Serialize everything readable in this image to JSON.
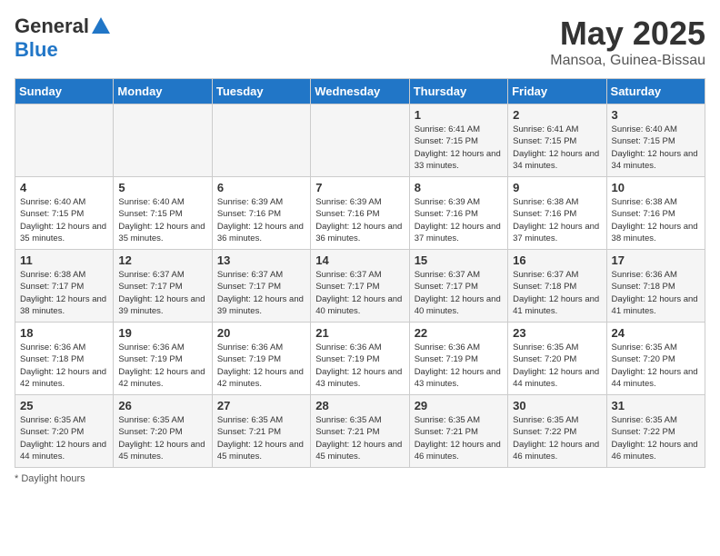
{
  "header": {
    "logo_general": "General",
    "logo_blue": "Blue",
    "title": "May 2025",
    "subtitle": "Mansoa, Guinea-Bissau"
  },
  "days_of_week": [
    "Sunday",
    "Monday",
    "Tuesday",
    "Wednesday",
    "Thursday",
    "Friday",
    "Saturday"
  ],
  "weeks": [
    [
      {
        "day": "",
        "sunrise": "",
        "sunset": "",
        "daylight": ""
      },
      {
        "day": "",
        "sunrise": "",
        "sunset": "",
        "daylight": ""
      },
      {
        "day": "",
        "sunrise": "",
        "sunset": "",
        "daylight": ""
      },
      {
        "day": "",
        "sunrise": "",
        "sunset": "",
        "daylight": ""
      },
      {
        "day": "1",
        "sunrise": "6:41 AM",
        "sunset": "7:15 PM",
        "daylight": "12 hours and 33 minutes."
      },
      {
        "day": "2",
        "sunrise": "6:41 AM",
        "sunset": "7:15 PM",
        "daylight": "12 hours and 34 minutes."
      },
      {
        "day": "3",
        "sunrise": "6:40 AM",
        "sunset": "7:15 PM",
        "daylight": "12 hours and 34 minutes."
      }
    ],
    [
      {
        "day": "4",
        "sunrise": "6:40 AM",
        "sunset": "7:15 PM",
        "daylight": "12 hours and 35 minutes."
      },
      {
        "day": "5",
        "sunrise": "6:40 AM",
        "sunset": "7:15 PM",
        "daylight": "12 hours and 35 minutes."
      },
      {
        "day": "6",
        "sunrise": "6:39 AM",
        "sunset": "7:16 PM",
        "daylight": "12 hours and 36 minutes."
      },
      {
        "day": "7",
        "sunrise": "6:39 AM",
        "sunset": "7:16 PM",
        "daylight": "12 hours and 36 minutes."
      },
      {
        "day": "8",
        "sunrise": "6:39 AM",
        "sunset": "7:16 PM",
        "daylight": "12 hours and 37 minutes."
      },
      {
        "day": "9",
        "sunrise": "6:38 AM",
        "sunset": "7:16 PM",
        "daylight": "12 hours and 37 minutes."
      },
      {
        "day": "10",
        "sunrise": "6:38 AM",
        "sunset": "7:16 PM",
        "daylight": "12 hours and 38 minutes."
      }
    ],
    [
      {
        "day": "11",
        "sunrise": "6:38 AM",
        "sunset": "7:17 PM",
        "daylight": "12 hours and 38 minutes."
      },
      {
        "day": "12",
        "sunrise": "6:37 AM",
        "sunset": "7:17 PM",
        "daylight": "12 hours and 39 minutes."
      },
      {
        "day": "13",
        "sunrise": "6:37 AM",
        "sunset": "7:17 PM",
        "daylight": "12 hours and 39 minutes."
      },
      {
        "day": "14",
        "sunrise": "6:37 AM",
        "sunset": "7:17 PM",
        "daylight": "12 hours and 40 minutes."
      },
      {
        "day": "15",
        "sunrise": "6:37 AM",
        "sunset": "7:17 PM",
        "daylight": "12 hours and 40 minutes."
      },
      {
        "day": "16",
        "sunrise": "6:37 AM",
        "sunset": "7:18 PM",
        "daylight": "12 hours and 41 minutes."
      },
      {
        "day": "17",
        "sunrise": "6:36 AM",
        "sunset": "7:18 PM",
        "daylight": "12 hours and 41 minutes."
      }
    ],
    [
      {
        "day": "18",
        "sunrise": "6:36 AM",
        "sunset": "7:18 PM",
        "daylight": "12 hours and 42 minutes."
      },
      {
        "day": "19",
        "sunrise": "6:36 AM",
        "sunset": "7:19 PM",
        "daylight": "12 hours and 42 minutes."
      },
      {
        "day": "20",
        "sunrise": "6:36 AM",
        "sunset": "7:19 PM",
        "daylight": "12 hours and 42 minutes."
      },
      {
        "day": "21",
        "sunrise": "6:36 AM",
        "sunset": "7:19 PM",
        "daylight": "12 hours and 43 minutes."
      },
      {
        "day": "22",
        "sunrise": "6:36 AM",
        "sunset": "7:19 PM",
        "daylight": "12 hours and 43 minutes."
      },
      {
        "day": "23",
        "sunrise": "6:35 AM",
        "sunset": "7:20 PM",
        "daylight": "12 hours and 44 minutes."
      },
      {
        "day": "24",
        "sunrise": "6:35 AM",
        "sunset": "7:20 PM",
        "daylight": "12 hours and 44 minutes."
      }
    ],
    [
      {
        "day": "25",
        "sunrise": "6:35 AM",
        "sunset": "7:20 PM",
        "daylight": "12 hours and 44 minutes."
      },
      {
        "day": "26",
        "sunrise": "6:35 AM",
        "sunset": "7:20 PM",
        "daylight": "12 hours and 45 minutes."
      },
      {
        "day": "27",
        "sunrise": "6:35 AM",
        "sunset": "7:21 PM",
        "daylight": "12 hours and 45 minutes."
      },
      {
        "day": "28",
        "sunrise": "6:35 AM",
        "sunset": "7:21 PM",
        "daylight": "12 hours and 45 minutes."
      },
      {
        "day": "29",
        "sunrise": "6:35 AM",
        "sunset": "7:21 PM",
        "daylight": "12 hours and 46 minutes."
      },
      {
        "day": "30",
        "sunrise": "6:35 AM",
        "sunset": "7:22 PM",
        "daylight": "12 hours and 46 minutes."
      },
      {
        "day": "31",
        "sunrise": "6:35 AM",
        "sunset": "7:22 PM",
        "daylight": "12 hours and 46 minutes."
      }
    ]
  ],
  "footer": {
    "daylight_label": "Daylight hours"
  }
}
